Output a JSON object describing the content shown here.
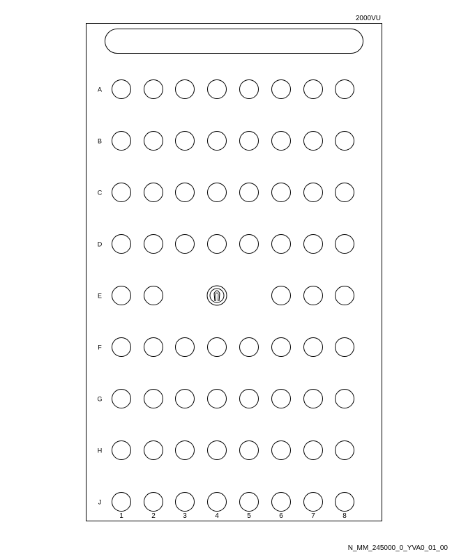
{
  "model_label": "2000VU",
  "drawing_id": "N_MM_245000_0_YVA0_01_00",
  "rows": [
    "A",
    "B",
    "C",
    "D",
    "E",
    "F",
    "G",
    "H",
    "J"
  ],
  "columns": [
    "1",
    "2",
    "3",
    "4",
    "5",
    "6",
    "7",
    "8"
  ],
  "empty_positions": [
    "E3",
    "E5"
  ],
  "key_positions": [
    "E4"
  ],
  "colors": {
    "line": "#000000",
    "background": "#ffffff"
  }
}
